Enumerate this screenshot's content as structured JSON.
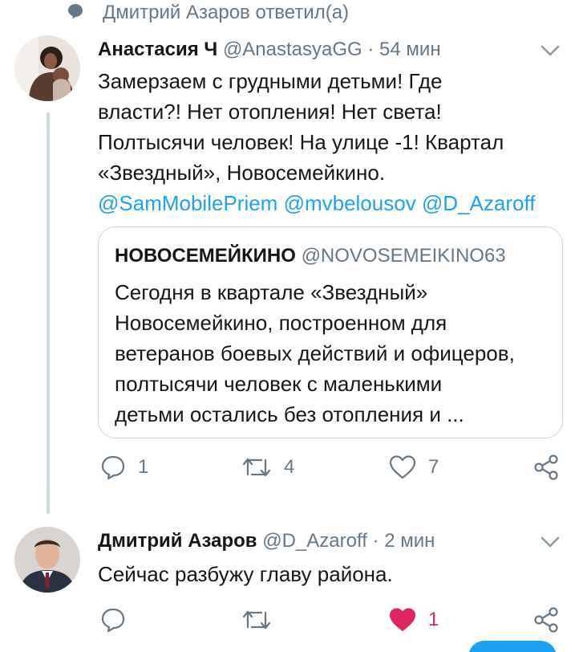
{
  "reply_context": {
    "text": "Дмитрий Азаров ответил(а)",
    "icon": "speech-bubble-icon"
  },
  "tweet1": {
    "name": "Анастасия Ч",
    "handle": "@AnastasyaGG",
    "separator": "·",
    "time": "54 мин",
    "lines": [
      "Замерзаем с грудными детьми! Где",
      "власти?! Нет отопления! Нет света!",
      "Полтысячи человек! На улице -1! Квартал",
      "«Звездный», Новосемейкино."
    ],
    "mentions": "@SamMobilePriem @mvbelousov @D_Azaroff",
    "quote": {
      "name": "НОВОСЕМЕЙКИНО",
      "handle": "@NOVOSEMEIKINO63",
      "lines": [
        "Сегодня в квартале «Звездный»",
        "Новосемейкино, построенном для",
        "ветеранов боевых действий и офицеров,",
        "полтысячи человек с маленькими",
        "детьми остались без отопления и ..."
      ]
    },
    "actions": {
      "reply_count": "1",
      "retweet_count": "4",
      "like_count": "7"
    }
  },
  "tweet2": {
    "name": "Дмитрий Азаров",
    "handle": "@D_Azaroff",
    "separator": "·",
    "time": "2 мин",
    "text": "Сейчас разбужу главу района.",
    "actions": {
      "like_count": "1",
      "liked": true
    }
  },
  "colors": {
    "link": "#1da1f2",
    "muted": "#657786",
    "like": "#e0245e",
    "border": "#ccd6dd"
  }
}
